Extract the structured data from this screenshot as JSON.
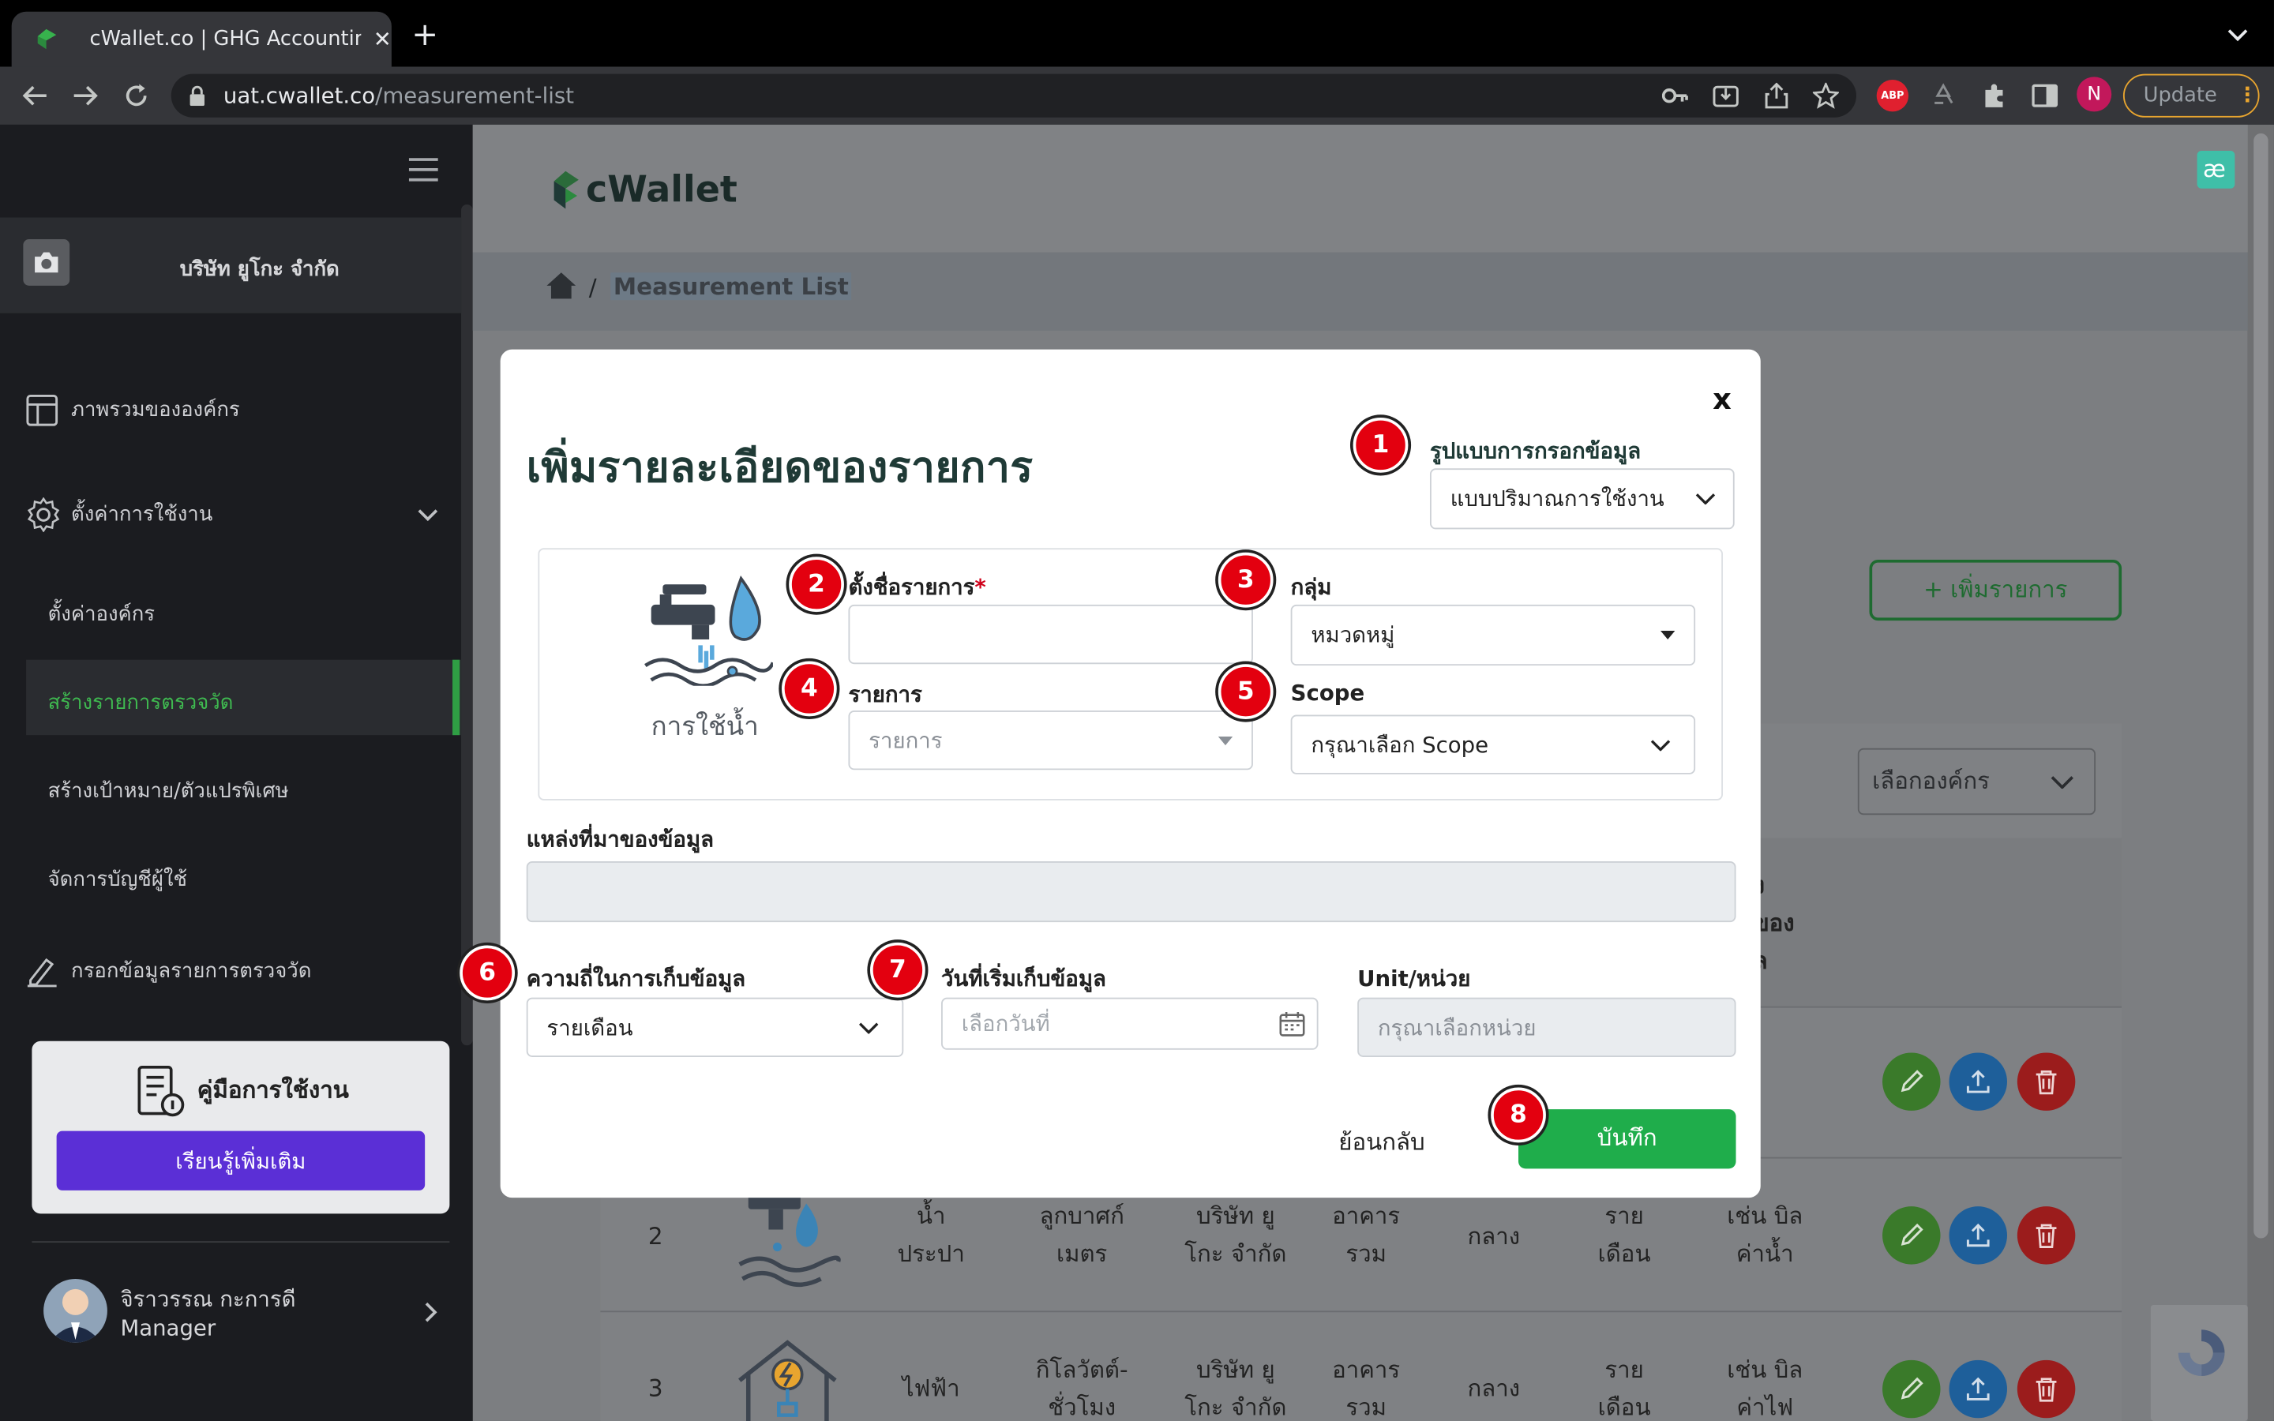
{
  "browser": {
    "tab_title": "cWallet.co | GHG Accounting S",
    "url_domain": "uat.cwallet.co",
    "url_path": "/measurement-list",
    "update_label": "Update",
    "profile_initial": "N",
    "abp_label": "ABP"
  },
  "sidebar": {
    "company": "บริษัท ยูโกะ จำกัด",
    "items": [
      {
        "label": "ภาพรวมขององค์กร"
      },
      {
        "label": "ตั้งค่าการใช้งาน"
      },
      {
        "label": "ตั้งค่าองค์กร"
      },
      {
        "label": "สร้างรายการตรวจวัด"
      },
      {
        "label": "สร้างเป้าหมาย/ตัวแปรพิเศษ"
      },
      {
        "label": "จัดการบัญชีผู้ใช้"
      },
      {
        "label": "กรอกข้อมูลรายการตรวจวัด"
      }
    ],
    "manual_title": "คู่มือการใช้งาน",
    "manual_button": "เรียนรู้เพิ่มเติม",
    "user_name": "จิราวรรณ กะการดี",
    "user_role": "Manager"
  },
  "page": {
    "logo_text": "cWallet",
    "breadcrumb": "Measurement List",
    "add_button": "+ เพิ่มรายการ",
    "org_select": "เลือกองค์กร",
    "partial_header": [
      "ง",
      "ของ",
      "ล"
    ],
    "rows": [
      {
        "no": "2",
        "type": "น้ำ\nประปา",
        "unit": "ลูกบาศก์\nเมตร",
        "company": "บริษัท ยู\nโกะ จำกัด",
        "location": "อาคาร\nรวม",
        "size": "กลาง",
        "freq": "ราย\nเดือน",
        "source": "เช่น บิล\nค่าน้ำ"
      },
      {
        "no": "3",
        "type": "ไฟฟ้า",
        "unit": "กิโลวัตต์-\nชั่วโมง",
        "company": "บริษัท ยู\nโกะ จำกัด",
        "location": "อาคาร\nรวม",
        "size": "กลาง",
        "freq": "ราย\nเดือน",
        "source": "เช่น บิล\nค่าไฟ"
      }
    ]
  },
  "modal": {
    "title": "เพิ่มรายละเอียดของรายการ",
    "close": "x",
    "input_mode_label": "รูปแบบการกรอกข้อมูล",
    "input_mode_value": "แบบปริมาณการใช้งาน",
    "icon_caption": "การใช้น้ำ",
    "name_label": "ตั้งชื่อรายการ",
    "required_mark": "*",
    "name_value": "",
    "group_label": "กลุ่ม",
    "group_value": "หมวดหมู่",
    "item_label": "รายการ",
    "item_placeholder": "รายการ",
    "scope_label": "Scope",
    "scope_value": "กรุณาเลือก Scope",
    "source_label": "แหล่งที่มาของข้อมูล",
    "source_value": "",
    "freq_label": "ความถี่ในการเก็บข้อมูล",
    "freq_value": "รายเดือน",
    "start_label": "วันที่เริ่มเก็บข้อมูล",
    "start_placeholder": "เลือกวันที่",
    "unit_label": "Unit/หน่วย",
    "unit_placeholder": "กรุณาเลือกหน่วย",
    "back_button": "ย้อนกลับ",
    "save_button": "บันทึก"
  },
  "badges": [
    "1",
    "2",
    "3",
    "4",
    "5",
    "6",
    "7",
    "8"
  ],
  "colors": {
    "accent_green": "#1fad4b",
    "brand_dark": "#1f3a36",
    "badge_red": "#e3000f",
    "purple": "#5b2fd6"
  }
}
